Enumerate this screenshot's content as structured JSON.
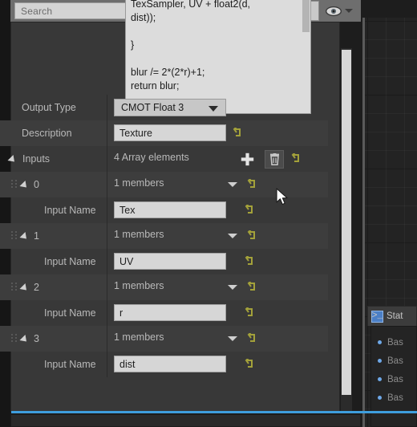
{
  "toolbar": {
    "search_placeholder": "Search",
    "search_value": "",
    "search_icon": "magnifier-icon",
    "grid_button_icon": "grid-view-icon",
    "eye_button_icon": "visibility-eye-icon",
    "eye_dropdown_icon": "chevron-down-icon"
  },
  "code_editor": {
    "lines": [
      "TexSampler, UV + float2(d,",
      "dist));",
      "",
      "}",
      "",
      "blur /= 2*(2*r)+1;",
      "return blur;"
    ]
  },
  "details": {
    "rows": [
      {
        "label": "Output Type",
        "type": "combo",
        "value": "CMOT Float 3"
      },
      {
        "label": "Description",
        "type": "field",
        "value": "Texture",
        "reset": true
      },
      {
        "label": "Inputs",
        "type": "array_header",
        "value": "4 Array elements",
        "add_icon": "plus-icon",
        "delete_icon": "trash-icon",
        "reset": true
      },
      {
        "label": "0",
        "type": "array_index",
        "value": "1 members",
        "reset": true
      },
      {
        "label": "Input Name",
        "type": "field",
        "value": "Tex",
        "reset": true
      },
      {
        "label": "1",
        "type": "array_index",
        "value": "1 members",
        "reset": true
      },
      {
        "label": "Input Name",
        "type": "field",
        "value": "UV",
        "reset": true
      },
      {
        "label": "2",
        "type": "array_index",
        "value": "1 members",
        "reset": true
      },
      {
        "label": "Input Name",
        "type": "field",
        "value": "r",
        "reset": true
      },
      {
        "label": "3",
        "type": "array_index",
        "value": "1 members",
        "reset": true
      },
      {
        "label": "Input Name",
        "type": "field",
        "value": "dist",
        "reset": true
      }
    ]
  },
  "stats_panel": {
    "tab_label": "Stat",
    "tab_icon": "console-icon",
    "items": [
      {
        "label": "Bas"
      },
      {
        "label": "Bas"
      },
      {
        "label": "Bas"
      },
      {
        "label": "Bas"
      }
    ]
  },
  "colors": {
    "accent_blue": "#3e9ede",
    "panel_bg": "#383838",
    "toolbar_bg": "#6e6e6e",
    "reset_arrow": "#a3a13a",
    "bullet_blue": "#6ea8e8"
  }
}
